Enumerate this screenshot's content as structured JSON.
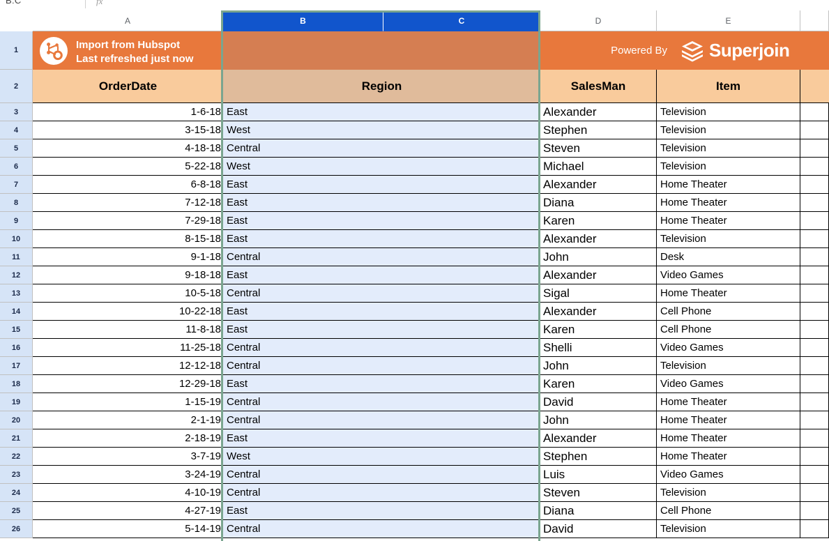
{
  "formula_bar": {
    "name_box": "B:C",
    "fx_label": "fx"
  },
  "grid": {
    "column_headers": [
      {
        "label": "A",
        "selected": false
      },
      {
        "label": "B",
        "selected": true
      },
      {
        "label": "C",
        "selected": true
      },
      {
        "label": "D",
        "selected": false
      },
      {
        "label": "E",
        "selected": false
      }
    ],
    "row_numbers": [
      "1",
      "2",
      "3",
      "4",
      "5",
      "6",
      "7",
      "8",
      "9",
      "10",
      "11",
      "12",
      "13",
      "14",
      "15",
      "16",
      "17",
      "18",
      "19",
      "20",
      "21",
      "22",
      "23",
      "24",
      "25",
      "26"
    ],
    "selection_range": "B:C"
  },
  "banner": {
    "hubspot_icon": "hubspot-sprocket-icon",
    "title_line1": "Import from Hubspot",
    "title_line2": "Last refreshed just now",
    "powered_by_label": "Powered By",
    "brand_icon": "superjoin-stack-icon",
    "brand_name": "Superjoin"
  },
  "table": {
    "headers": {
      "order_date": "OrderDate",
      "region": "Region",
      "salesman": "SalesMan",
      "item": "Item"
    },
    "rows": [
      {
        "row": "3",
        "date": "1-6-18",
        "region": "East",
        "salesman": "Alexander",
        "item": "Television"
      },
      {
        "row": "4",
        "date": "3-15-18",
        "region": "West",
        "salesman": "Stephen",
        "item": "Television"
      },
      {
        "row": "5",
        "date": "4-18-18",
        "region": "Central",
        "salesman": "Steven",
        "item": "Television"
      },
      {
        "row": "6",
        "date": "5-22-18",
        "region": "West",
        "salesman": "Michael",
        "item": "Television"
      },
      {
        "row": "7",
        "date": "6-8-18",
        "region": "East",
        "salesman": "Alexander",
        "item": "Home Theater"
      },
      {
        "row": "8",
        "date": "7-12-18",
        "region": "East",
        "salesman": "Diana",
        "item": "Home Theater"
      },
      {
        "row": "9",
        "date": "7-29-18",
        "region": "East",
        "salesman": "Karen",
        "item": "Home Theater"
      },
      {
        "row": "10",
        "date": "8-15-18",
        "region": "East",
        "salesman": "Alexander",
        "item": "Television"
      },
      {
        "row": "11",
        "date": "9-1-18",
        "region": "Central",
        "salesman": "John",
        "item": "Desk"
      },
      {
        "row": "12",
        "date": "9-18-18",
        "region": "East",
        "salesman": "Alexander",
        "item": "Video Games"
      },
      {
        "row": "13",
        "date": "10-5-18",
        "region": "Central",
        "salesman": "Sigal",
        "item": "Home Theater"
      },
      {
        "row": "14",
        "date": "10-22-18",
        "region": "East",
        "salesman": "Alexander",
        "item": "Cell Phone"
      },
      {
        "row": "15",
        "date": "11-8-18",
        "region": "East",
        "salesman": "Karen",
        "item": "Cell Phone"
      },
      {
        "row": "16",
        "date": "11-25-18",
        "region": "Central",
        "salesman": "Shelli",
        "item": "Video Games"
      },
      {
        "row": "17",
        "date": "12-12-18",
        "region": "Central",
        "salesman": "John",
        "item": "Television"
      },
      {
        "row": "18",
        "date": "12-29-18",
        "region": "East",
        "salesman": "Karen",
        "item": "Video Games"
      },
      {
        "row": "19",
        "date": "1-15-19",
        "region": "Central",
        "salesman": "David",
        "item": "Home Theater"
      },
      {
        "row": "20",
        "date": "2-1-19",
        "region": "Central",
        "salesman": "John",
        "item": "Home Theater"
      },
      {
        "row": "21",
        "date": "2-18-19",
        "region": "East",
        "salesman": "Alexander",
        "item": "Home Theater"
      },
      {
        "row": "22",
        "date": "3-7-19",
        "region": "West",
        "salesman": "Stephen",
        "item": "Home Theater"
      },
      {
        "row": "23",
        "date": "3-24-19",
        "region": "Central",
        "salesman": "Luis",
        "item": "Video Games"
      },
      {
        "row": "24",
        "date": "4-10-19",
        "region": "Central",
        "salesman": "Steven",
        "item": "Television"
      },
      {
        "row": "25",
        "date": "4-27-19",
        "region": "East",
        "salesman": "Diana",
        "item": "Cell Phone"
      },
      {
        "row": "26",
        "date": "5-14-19",
        "region": "Central",
        "salesman": "David",
        "item": "Television"
      }
    ]
  },
  "colors": {
    "banner_orange": "#e8783c",
    "banner_orange_selected": "#d57e52",
    "header_peach": "#f9cb9c",
    "header_peach_selected": "#e0bb9b",
    "selection_border": "#7aa58f",
    "column_header_selected": "#1155cc",
    "row_header_blue": "#d6e4f7",
    "region_cell_tint": "#e3ecfb"
  }
}
